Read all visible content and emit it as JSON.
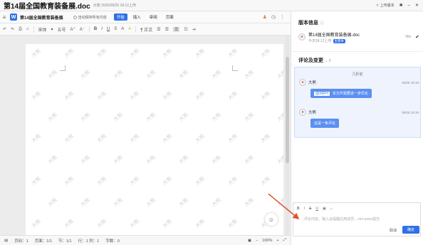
{
  "titlebar": {
    "title": "第14届全国教育装备展.doc",
    "meta": "大熊 2020/09/25 18:12上传",
    "upload_version": "上传版本",
    "icons": [
      "pin-icon",
      "minimize-icon",
      "close-icon"
    ]
  },
  "toolbar1": {
    "filename": "第14届全国教育装备展",
    "autosave_label": "自动保存所有内容",
    "tabs": [
      {
        "label": "开始",
        "active": true
      },
      {
        "label": "插入",
        "active": false
      },
      {
        "label": "审阅",
        "active": false
      },
      {
        "label": "页面",
        "active": false
      }
    ]
  },
  "toolbar2": {
    "font": "宋体",
    "font_size": "五号",
    "bold": "B",
    "italic": "I",
    "underline": "U",
    "strike": "S",
    "paragraph": "正文"
  },
  "document": {
    "watermark": "大熊"
  },
  "statusbar": {
    "word_count": "页码：1",
    "page": "页面：1/1",
    "section": "节：1/1",
    "position": "行：1  列：1",
    "chars": "字数：0",
    "zoom": "100%"
  },
  "panel": {
    "version_title": "版本信息",
    "version_count": "1",
    "version": {
      "name": "第14届全国教育装备展.doc",
      "date": "今天18:12上传",
      "badge": "主版本",
      "size": "9kb"
    },
    "comments_title": "评论及变更",
    "comments_count": "3",
    "expand_label": "几秒前",
    "comments": [
      {
        "author": "大熊",
        "time": "09/25 18:19",
        "mention": "@X9FH",
        "text": "本文件需要进一步优化"
      },
      {
        "author": "大熊",
        "time": "09/25 18:19",
        "mention": "",
        "text": "这是一条评论"
      }
    ],
    "editor": {
      "placeholder": "评论内容，输入@提醒应用成员，ctrl+enter提交",
      "cancel": "取消",
      "ok": "确定"
    }
  },
  "colors": {
    "accent": "#2f6fe8",
    "annotation_arrow": "#e0522a"
  }
}
